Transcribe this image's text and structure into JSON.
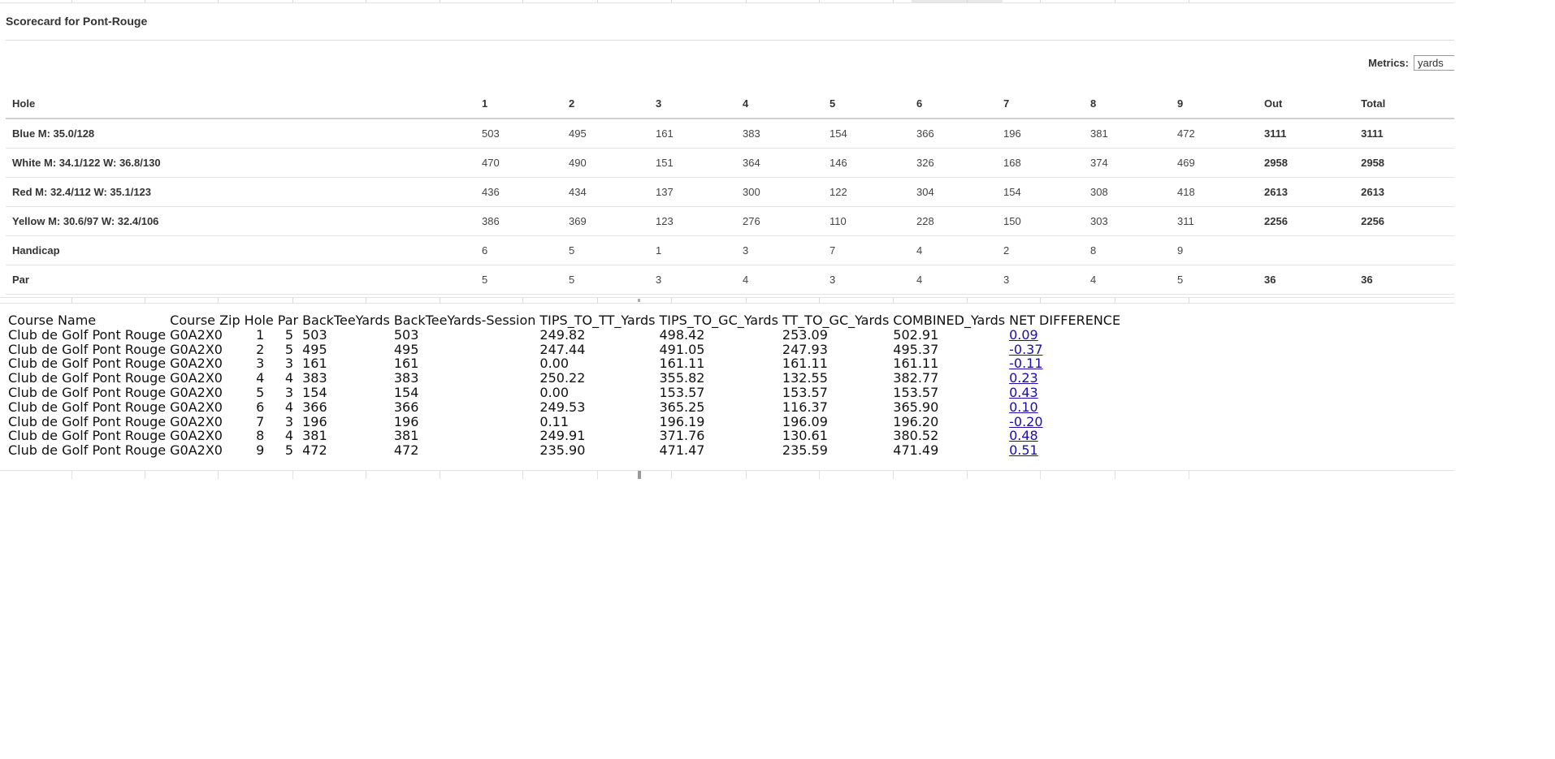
{
  "scorecard": {
    "title": "Scorecard for Pont-Rouge",
    "metrics_label": "Metrics:",
    "metrics_value": "yards",
    "header": [
      "Hole",
      "1",
      "2",
      "3",
      "4",
      "5",
      "6",
      "7",
      "8",
      "9",
      "Out",
      "Total"
    ],
    "rows": [
      {
        "label": "Blue M: 35.0/128",
        "values": [
          "503",
          "495",
          "161",
          "383",
          "154",
          "366",
          "196",
          "381",
          "472"
        ],
        "out": "3111",
        "total": "3111"
      },
      {
        "label": "White M: 34.1/122 W: 36.8/130",
        "values": [
          "470",
          "490",
          "151",
          "364",
          "146",
          "326",
          "168",
          "374",
          "469"
        ],
        "out": "2958",
        "total": "2958"
      },
      {
        "label": "Red M: 32.4/112 W: 35.1/123",
        "values": [
          "436",
          "434",
          "137",
          "300",
          "122",
          "304",
          "154",
          "308",
          "418"
        ],
        "out": "2613",
        "total": "2613"
      },
      {
        "label": "Yellow M: 30.6/97 W: 32.4/106",
        "values": [
          "386",
          "369",
          "123",
          "276",
          "110",
          "228",
          "150",
          "303",
          "311"
        ],
        "out": "2256",
        "total": "2256"
      },
      {
        "label": "Handicap",
        "values": [
          "6",
          "5",
          "1",
          "3",
          "7",
          "4",
          "2",
          "8",
          "9"
        ],
        "out": "",
        "total": ""
      },
      {
        "label": "Par",
        "values": [
          "5",
          "5",
          "3",
          "4",
          "3",
          "4",
          "3",
          "4",
          "5"
        ],
        "out": "36",
        "total": "36"
      }
    ]
  },
  "datatable": {
    "columns": [
      "Course Name",
      "Course Zip",
      "Hole",
      "Par",
      "BackTeeYards",
      "BackTeeYards-Session",
      "TIPS_TO_TT_Yards",
      "TIPS_TO_GC_Yards",
      "TT_TO_GC_Yards",
      "COMBINED_Yards",
      "NET DIFFERENCE"
    ],
    "rows": [
      [
        "Club de Golf Pont Rouge",
        "G0A2X0",
        "1",
        "5",
        "503",
        "503",
        "249.82",
        "498.42",
        "253.09",
        "502.91",
        "0.09"
      ],
      [
        "Club de Golf Pont Rouge",
        "G0A2X0",
        "2",
        "5",
        "495",
        "495",
        "247.44",
        "491.05",
        "247.93",
        "495.37",
        "-0.37"
      ],
      [
        "Club de Golf Pont Rouge",
        "G0A2X0",
        "3",
        "3",
        "161",
        "161",
        "0.00",
        "161.11",
        "161.11",
        "161.11",
        "-0.11"
      ],
      [
        "Club de Golf Pont Rouge",
        "G0A2X0",
        "4",
        "4",
        "383",
        "383",
        "250.22",
        "355.82",
        "132.55",
        "382.77",
        "0.23"
      ],
      [
        "Club de Golf Pont Rouge",
        "G0A2X0",
        "5",
        "3",
        "154",
        "154",
        "0.00",
        "153.57",
        "153.57",
        "153.57",
        "0.43"
      ],
      [
        "Club de Golf Pont Rouge",
        "G0A2X0",
        "6",
        "4",
        "366",
        "366",
        "249.53",
        "365.25",
        "116.37",
        "365.90",
        "0.10"
      ],
      [
        "Club de Golf Pont Rouge",
        "G0A2X0",
        "7",
        "3",
        "196",
        "196",
        "0.11",
        "196.19",
        "196.09",
        "196.20",
        "-0.20"
      ],
      [
        "Club de Golf Pont Rouge",
        "G0A2X0",
        "8",
        "4",
        "381",
        "381",
        "249.91",
        "371.76",
        "130.61",
        "380.52",
        "0.48"
      ],
      [
        "Club de Golf Pont Rouge",
        "G0A2X0",
        "9",
        "5",
        "472",
        "472",
        "235.90",
        "471.47",
        "235.59",
        "471.49",
        "0.51"
      ]
    ]
  }
}
